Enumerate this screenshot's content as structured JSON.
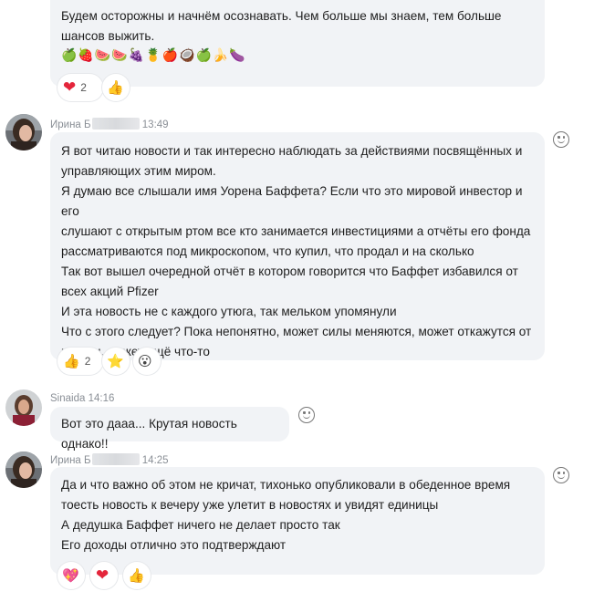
{
  "messages": [
    {
      "text": "Будем осторожны и начнём осознавать. Чем больше мы знаем, тем больше\nшансов выжить.",
      "emoji_line": "🍏🍓🍉🍉🍇🍍🍎🥥🍏🍌🍆",
      "reactions": [
        {
          "icon": "heart-icon",
          "glyph": "❤",
          "count": "2"
        },
        {
          "icon": "thumbs-up-icon",
          "glyph": "👍",
          "count": ""
        }
      ]
    },
    {
      "author": "Ирина Б",
      "time": "13:49",
      "text": "Я вот читаю новости и так интересно наблюдать за действиями посвящённых и\nуправляющих этим миром.\nЯ думаю все слышали имя Уорена Баффета? Если что это мировой инвестор и его\nслушают с открытым ртом все кто занимается инвестициями а отчёты его фонда\nрассматриваются под микроскопом, что купил, что продал и на сколько\nТак вот вышел очередной отчёт в котором говорится что Баффет избавился от\nвсех акций Pfizer\nИ эта новость не с каждого утюга, так мельком упомянули\nЧто с этого следует? Пока непонятно, может силы меняются, может откажутся от\nвакцин, может ещё что-то",
      "reactions": [
        {
          "icon": "thumbs-up-icon",
          "glyph": "👍",
          "count": "2"
        },
        {
          "icon": "star-icon",
          "glyph": "⭐",
          "count": ""
        },
        {
          "icon": "shocked-face-icon",
          "glyph": "😮",
          "count": ""
        }
      ]
    },
    {
      "author": "Sinaida",
      "time": "14:16",
      "text": "Вот это дааа... Крутая новость однако!!"
    },
    {
      "author": "Ирина Б",
      "time": "14:25",
      "text": "Да и что важно об этом не кричат, тихонько опубликовали в обеденное время\nтоесть новость к вечеру уже улетит в новостях и увидят единицы\nА дедушка Баффет ничего не делает просто так\nЕго доходы отлично это подтверждают",
      "reactions": [
        {
          "icon": "sparkling-heart-icon",
          "glyph": "💖",
          "count": ""
        },
        {
          "icon": "heart-icon",
          "glyph": "❤",
          "count": ""
        },
        {
          "icon": "thumbs-up-icon",
          "glyph": "👍",
          "count": ""
        }
      ]
    }
  ],
  "colors": {
    "bubble": "#f1f3f6",
    "meta_text": "#8a8f96",
    "heart": "#e4253b"
  }
}
